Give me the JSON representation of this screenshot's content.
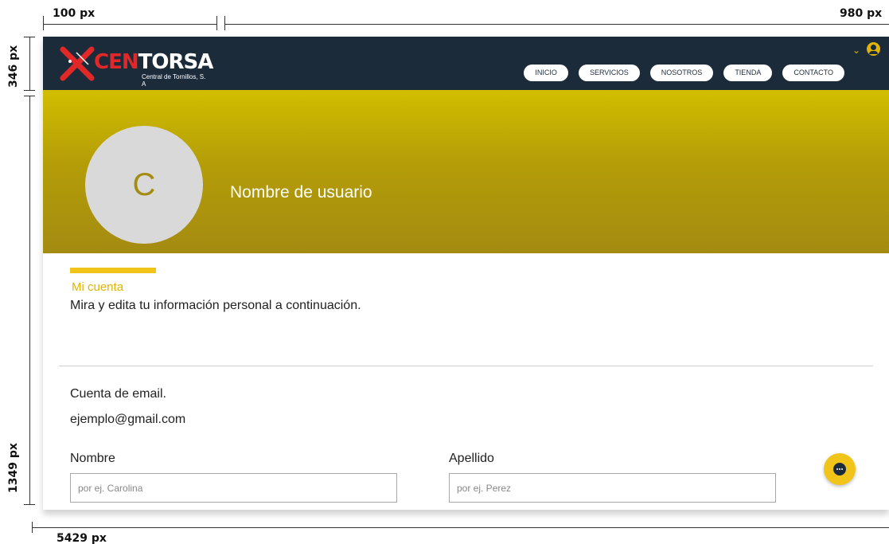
{
  "specs": {
    "width_left": "100 px",
    "width_right": "980 px",
    "header_height": "346 px",
    "body_height": "1349 px",
    "total_height": "5429 px"
  },
  "brand": {
    "name_red": "CEN",
    "name_white": "TORSA",
    "tagline": "Central de Tornillos, S. A"
  },
  "nav": {
    "items": [
      "INICIO",
      "SERVICIOS",
      "NOSOTROS",
      "TIENDA",
      "CONTACTO"
    ]
  },
  "profile": {
    "avatar_initial": "C",
    "username": "Nombre de usuario"
  },
  "account": {
    "title": "Mi cuenta",
    "description": "Mira y edita tu información personal a continuación.",
    "email_label": "Cuenta de email.",
    "email_value": "ejemplo@gmail.com"
  },
  "form": {
    "first_name_label": "Nombre",
    "first_name_placeholder": "por ej. Carolina",
    "last_name_label": "Apellido",
    "last_name_placeholder": "por ej. Perez"
  },
  "colors": {
    "navbar": "#1c2b3a",
    "accent": "#e0b400",
    "brand_red": "#e02828"
  },
  "icons": {
    "account_dropdown": "chevron-down-icon",
    "account": "user-icon",
    "chat": "chat-icon"
  }
}
